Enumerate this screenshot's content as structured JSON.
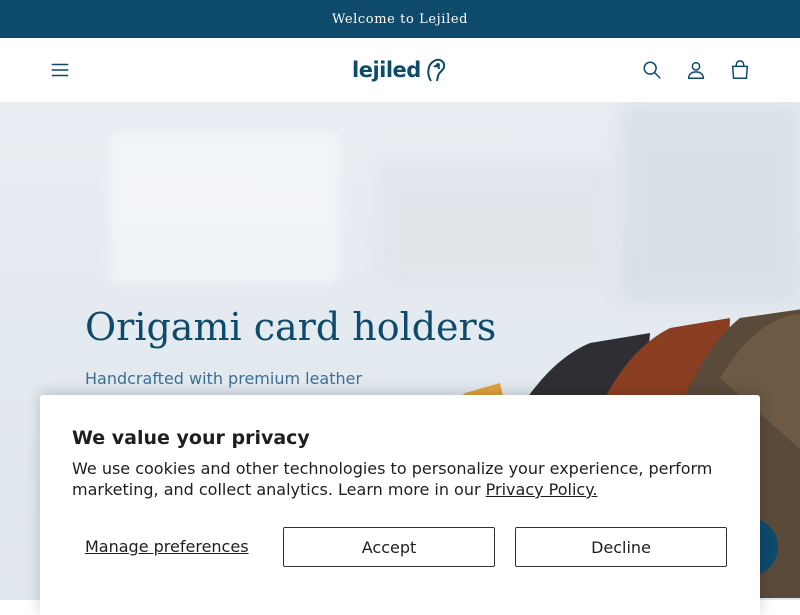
{
  "announcement": {
    "text": "Welcome to Lejiled"
  },
  "header": {
    "logo_text": "lejiled",
    "icons": {
      "menu": "menu-icon",
      "search": "search-icon",
      "account": "account-icon",
      "cart": "cart-icon"
    }
  },
  "hero": {
    "title": "Origami card holders",
    "subtitle": "Handcrafted with premium leather"
  },
  "cookie_banner": {
    "title": "We value your privacy",
    "text": "We use cookies and other technologies to personalize your experience, perform marketing, and collect analytics. Learn more in our ",
    "policy_link": "Privacy Policy.",
    "manage_label": "Manage preferences",
    "accept_label": "Accept",
    "decline_label": "Decline"
  },
  "colors": {
    "brand": "#0e4a6b",
    "subtitle": "#3c6f93",
    "text": "#1e1e1e"
  }
}
